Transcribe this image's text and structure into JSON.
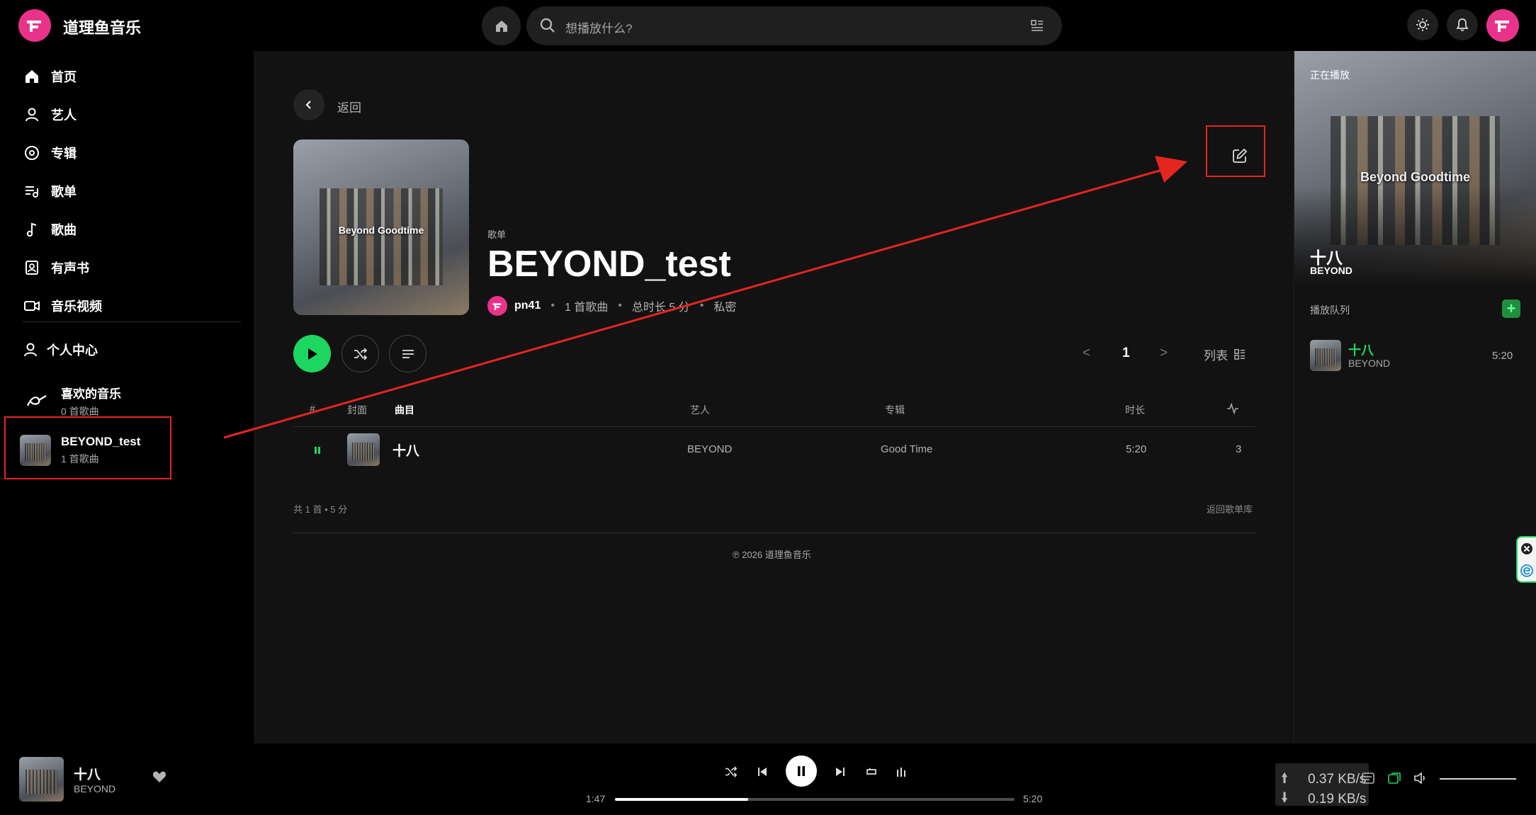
{
  "app": {
    "name": "道理鱼音乐"
  },
  "search": {
    "placeholder": "想播放什么?"
  },
  "sidebar": {
    "nav": [
      {
        "label": "首页",
        "icon": "home-icon"
      },
      {
        "label": "艺人",
        "icon": "person-icon"
      },
      {
        "label": "专辑",
        "icon": "disc-icon"
      },
      {
        "label": "歌单",
        "icon": "playlist-icon"
      },
      {
        "label": "歌曲",
        "icon": "music-note-icon"
      },
      {
        "label": "有声书",
        "icon": "audiobook-icon"
      },
      {
        "label": "音乐视频",
        "icon": "video-icon"
      }
    ],
    "personal": {
      "label": "个人中心",
      "icon": "person-icon"
    },
    "liked": {
      "title": "喜欢的音乐",
      "sub": "0 首歌曲"
    },
    "playlist": {
      "title": "BEYOND_test",
      "sub": "1 首歌曲"
    }
  },
  "main": {
    "back_label": "返回",
    "cover_text": "Beyond Goodtime",
    "kind": "歌单",
    "title": "BEYOND_test",
    "owner": "pn41",
    "track_count": "1 首歌曲",
    "duration_total": "总时长 5 分",
    "privacy": "私密",
    "pager": {
      "prev": "<",
      "page": "1",
      "next": ">"
    },
    "view_label": "列表",
    "columns": {
      "num": "#",
      "cover": "封面",
      "title": "曲目",
      "artist": "艺人",
      "album": "专辑",
      "duration": "时长"
    },
    "tracks": [
      {
        "title": "十八",
        "artist": "BEYOND",
        "album": "Good Time",
        "duration": "5:20",
        "plays": "3"
      }
    ],
    "summary": "共 1 首 • 5 分",
    "back_to_library": "返回歌单库",
    "copyright": "℗ 2026 道理鱼音乐"
  },
  "now_playing": {
    "label": "正在播放",
    "cover_text": "Beyond Goodtime",
    "title": "十八",
    "artist": "BEYOND",
    "queue_label": "播放队列",
    "queue": [
      {
        "title": "十八",
        "artist": "BEYOND",
        "duration": "5:20"
      }
    ]
  },
  "player": {
    "title": "十八",
    "artist": "BEYOND",
    "current_time": "1:47",
    "total_time": "5:20",
    "progress_fraction": 0.334,
    "upload_speed": "0.37 KB/s",
    "download_speed": "0.19 KB/s"
  },
  "colors": {
    "accent": "#1ed760",
    "brand": "#e9338b",
    "annotation": "#e5261f"
  }
}
